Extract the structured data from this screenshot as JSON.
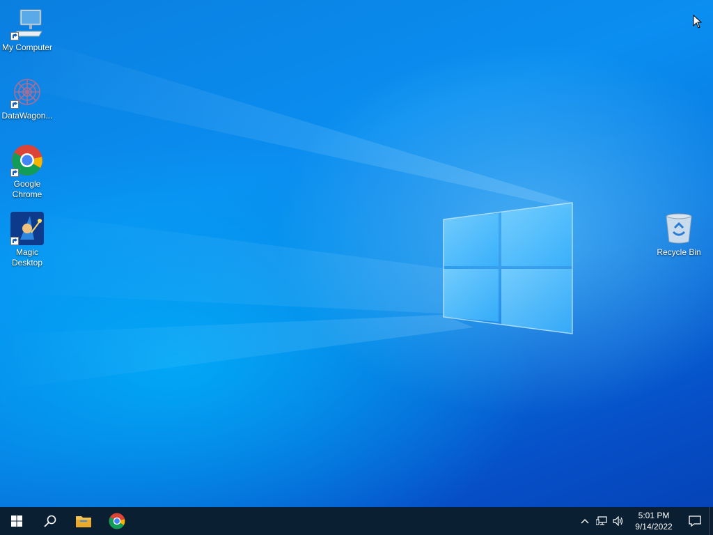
{
  "desktop": {
    "icons": [
      {
        "label": "My Computer",
        "icon": "computer-icon"
      },
      {
        "label": "DataWagon...",
        "icon": "datawagon-icon"
      },
      {
        "label": "Google Chrome",
        "icon": "chrome-icon"
      },
      {
        "label": "Magic Desktop",
        "icon": "magic-desktop-icon"
      },
      {
        "label": "Recycle Bin",
        "icon": "recycle-bin-icon"
      }
    ]
  },
  "taskbar": {
    "start": "start-icon",
    "search": "search-icon",
    "pinned": [
      "file-explorer-icon",
      "chrome-icon"
    ],
    "tray": {
      "icons": [
        "chevron-up-icon",
        "network-icon",
        "volume-icon"
      ],
      "time": "5:01 PM",
      "date": "9/14/2022",
      "notifications": "notification-icon"
    }
  },
  "colors": {
    "taskbar": "#0b1f33",
    "desktop_accent": "#0a8ef0"
  }
}
